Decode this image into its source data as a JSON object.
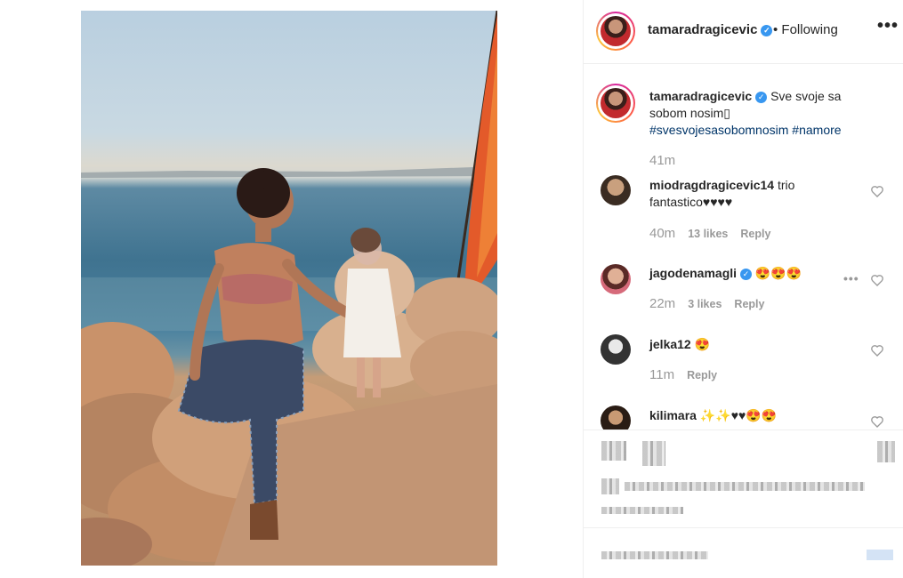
{
  "post": {
    "username": "tamaradragicevic",
    "follow_status": "• Following",
    "more_label": "•••"
  },
  "caption": {
    "username": "tamaradragicevic",
    "text": "Sve svoje sa sobom nosim▯",
    "text_line1": "Sve svoje sa",
    "text_line2": "sobom nosim▯",
    "hashtags": [
      "#svesvojesasobomnosim",
      "#namore"
    ],
    "time": "41m"
  },
  "comments": [
    {
      "username": "miodragdragicevic14",
      "text_line1": "trio",
      "text_line2": "fantastico♥♥♥♥",
      "time": "40m",
      "likes": "13 likes",
      "reply": "Reply"
    },
    {
      "username": "jagodenamagli",
      "text": "😍😍😍",
      "time": "22m",
      "likes": "3 likes",
      "reply": "Reply"
    },
    {
      "username": "jelka12",
      "text": "😍",
      "time": "11m",
      "reply": "Reply"
    },
    {
      "username": "kilimara",
      "text": "✨✨♥♥😍😍"
    }
  ],
  "icons": {
    "heart": "heart-icon",
    "verified": "verified-badge-icon",
    "more": "more-options-icon"
  },
  "colors": {
    "link": "#003569",
    "muted": "#999999",
    "verified": "#3897f0",
    "border": "#efefef"
  }
}
